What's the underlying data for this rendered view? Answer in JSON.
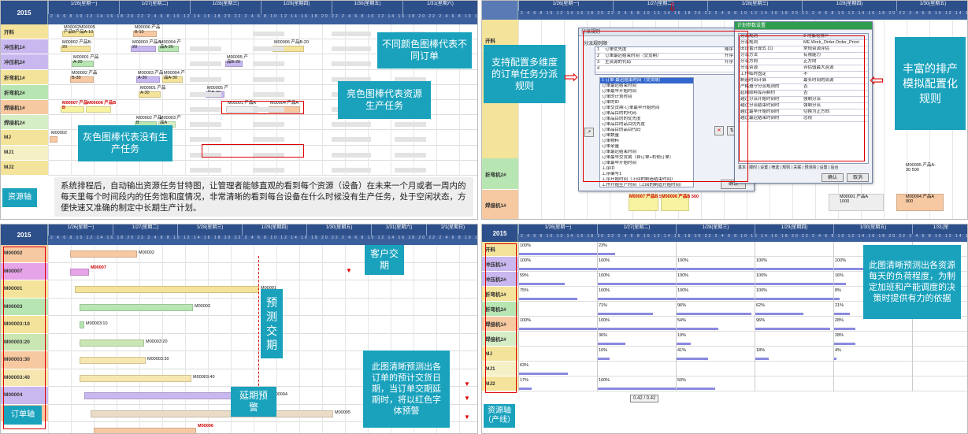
{
  "year": "2015",
  "days_p1": [
    "1/26(星期一)",
    "1/27(星期二)",
    "1/28(星期三)",
    "1/29(星期四)",
    "1/30(星期五)",
    "1/31(星期六)"
  ],
  "days_p3": [
    "1/26(星期一)",
    "1/27(星期二)",
    "1/28(星期三)",
    "1/29(星期四)",
    "1/30(星期五)",
    "1/31(星期六)",
    "2/1(星期日)"
  ],
  "days_p2": [
    "1/26(星期一)",
    "1/27(星期二)",
    "1/28(星期三)",
    "1/29(星期四)",
    "1/30(星期五)"
  ],
  "days_p4": [
    "1/26(星期一)",
    "1/27(星期二)",
    "1/28(星期三)",
    "1/29(星期四)",
    "1/30(星期五)",
    "1/31(星"
  ],
  "hours": "2 4 6 8 10 12 14 16 18 20 22",
  "resources": [
    "开料",
    "冲压机1#",
    "冲压机2#",
    "折弯机1#",
    "折弯机2#",
    "焊接机1#",
    "焊接机2#",
    "MJ",
    "MJ1",
    "MJ2"
  ],
  "resource_colors": [
    "#f4e39a",
    "#c9b8ef",
    "#c9b8ef",
    "#f4e39a",
    "#b8e6b3",
    "#f7c9a0",
    "#d6eec6",
    "#f4e39a",
    "#f6f0c6",
    "#f4e39a"
  ],
  "orders": [
    "M00002",
    "M00007",
    "M00001",
    "M00003",
    "M00003:10",
    "M00003:20",
    "M00003:30",
    "M00003:40",
    "M00004",
    "M00005"
  ],
  "order_colors": [
    "#f6c9a3",
    "#e6a3e8",
    "#f4e39a",
    "#b8e6b3",
    "#f4e39a",
    "#c9e6b3",
    "#f7c9a0",
    "#f6e6b0",
    "#c9b8ef",
    "#f6c9a3"
  ],
  "p1": {
    "labels": {
      "open": "M00002M00005 产品B产品A-10",
      "open2": "M00006 产品B-10",
      "p1a": "M00002 产品B-20",
      "p1b": "M00003 产品A-20",
      "p1c": "M00004 产品A-20",
      "p1d": "M00006 产品B-20",
      "p2a": "M00001 产品A-20",
      "p2b": "M00005 产品B-20",
      "f1a": "M00002 产品B-30",
      "f1b": "M00003 产品A-30",
      "f1c": "M00004 产品A-30",
      "f2a": "M00001 产品A-30",
      "f2b": "M00005 产品B-30",
      "w1a": "M00007 产品B",
      "w1b": "M00006 产品B",
      "w1c": "M00001 产品A",
      "w1d": "M00004 产品A",
      "w2a": "M00002 产品B",
      "w2b": "M00003 产品A",
      "mja": "M00002",
      "mj1a": "M00003"
    },
    "callout_colors": "不同颜色图棒代表不同订单",
    "callout_bright": "亮色图棒代表资源生产任务",
    "callout_gray": "灰色图棒代表没有生产任务",
    "desc": "系统排程后，自动输出资源任务甘特图，让管理者能够直观的看到每个资源（设备）在未来一个月或者一周内的每天里每个时间段内的任务饱和度情况，非常清晰的看到每台设备在什么时候没有生产任务，处于空闲状态，方便快速又准确的制定中长期生产计划。",
    "axis": "资源轴"
  },
  "p2": {
    "callout_left": "支持配置多维度的订单任务分派规则",
    "callout_right": "丰富的排产模拟配置化规则",
    "dlg1_title": "分派规则",
    "dlg1_head": "分派规则顺",
    "dlg1_rows": [
      {
        "n": "1",
        "name": "订单优先度",
        "ord": "降序"
      },
      {
        "n": "2",
        "name": "订单最迟结束时间（交货期）",
        "ord": "升序"
      },
      {
        "n": "3",
        "name": "主资源的代码",
        "ord": "升序"
      },
      {
        "n": "4",
        "name": "",
        "ord": ""
      }
    ],
    "dlg1_list": [
      "1 订单-最迟结束时间（交货期）",
      "订单最迟结束时间",
      "订单最早开始时间",
      "订单的计划时间",
      "订单的ID",
      "订单交货期-订单最早开始时间",
      "订单品目的的代码",
      "订单品目的的优先度",
      "订单品目的品目优先度",
      "订单品目的品目代码",
      "订单数量",
      "订单物料",
      "订单余量",
      "订单最迟结束时间",
      "订单最早交货期（自订单+右侧订单）",
      "订单最早开始时间",
      "工序ID",
      "工序编号1",
      "工序开始时间（上回的制造结束时间）",
      "工作开始生产时间（上回的制造开始时间）",
      "工作结束时间（上回的制造结束时间）"
    ],
    "dlg2_title": "计划参数设置",
    "dlg2_rows": [
      {
        "k": "分派规则",
        "v": "3-均衡化排产"
      },
      {
        "k": "分派规则",
        "v": "ME.Work_Order.Order_Priori"
      },
      {
        "k": "田设置计算式 (1)",
        "v": "常规资源评估"
      },
      {
        "k": "分派方法",
        "v": "有限能力"
      },
      {
        "k": "分派方向",
        "v": "正方向"
      },
      {
        "k": "分派资源",
        "v": "评估值最大资源"
      },
      {
        "k": "工作临时固定",
        "v": "不"
      },
      {
        "k": "制造时间计算",
        "v": "最长时间的资源"
      },
      {
        "k": "严格遵守分派规则的",
        "v": "否"
      },
      {
        "k": "起用原料库存制约",
        "v": "否"
      },
      {
        "k": "越过分派开始时刻时",
        "v": "强制分派"
      },
      {
        "k": "越过分派结束时刻时",
        "v": "强制分派"
      },
      {
        "k": "越过最早开始时刻时",
        "v": "切换为正方向"
      },
      {
        "k": "越过最迟结束时刻时",
        "v": "忽视"
      }
    ],
    "tabs": "基本 | 顺时 | 设置 | 筛选 | 规则 | 关联 | 预测资 | 设置 | 后台",
    "ok": "确认",
    "cancel": "取消",
    "ok2": "确认",
    "bars": [
      {
        "t": "M00007 产品B 500"
      },
      {
        "t": "M00006 产品B 500"
      },
      {
        "t": "M00001 产品A 1000"
      },
      {
        "t": "M00004 产品A 800"
      },
      {
        "t": "M00005 产品A-30 500"
      }
    ],
    "rows": [
      "开料",
      "折弯机2#",
      "焊接机1#"
    ]
  },
  "p3": {
    "labels": [
      "M00002",
      "M00007",
      "M00001",
      "M00003",
      "M00003:10",
      "M00003:20",
      "M00003:30",
      "M00003:40",
      "M00004",
      "M00005",
      "M00006",
      "M00006"
    ],
    "callout_customer": "客户交期",
    "callout_forecast": "预测交期",
    "callout_delay": "延期预警",
    "callout_desc": "此图清晰预测出各订单的预计交货日期，当订单交期延期时，将以红色字体预警",
    "axis": "订单轴"
  },
  "p4": {
    "loads": [
      [
        "100%",
        "23%",
        "",
        "",
        "",
        ""
      ],
      [
        "100%",
        "100%",
        "100%",
        "100%",
        "100%",
        ""
      ],
      [
        "59%",
        "100%",
        "100%",
        "100%",
        "16%",
        ""
      ],
      [
        "75%",
        "100%",
        "100%",
        "100%",
        "8%",
        ""
      ],
      [
        "",
        "71%",
        "96%",
        "62%",
        "21%",
        ""
      ],
      [
        "100%",
        "100%",
        "54%",
        "96%",
        "28%",
        ""
      ],
      [
        "",
        "36%",
        "19%",
        "",
        "28%",
        ""
      ],
      [
        "",
        "16%",
        "41%",
        "18%",
        "4%",
        ""
      ],
      [
        "63%",
        "",
        "",
        "",
        "",
        ""
      ],
      [
        "17%",
        "100%",
        "50%",
        "",
        "",
        ""
      ]
    ],
    "callout": "此图清晰预测出各资源每天的负荷程度，为制定加班和产能调度的决策时提供有力的依据",
    "axis": "资源轴（产线）",
    "zoom": "0.42 / 0.42"
  }
}
